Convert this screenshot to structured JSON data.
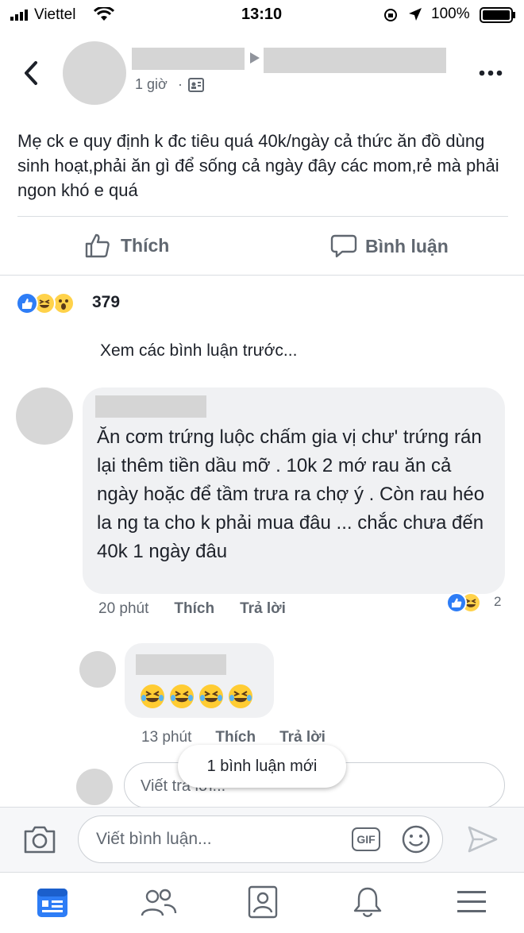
{
  "status_bar": {
    "carrier": "Viettel",
    "time": "13:10",
    "battery": "100%"
  },
  "post": {
    "time": "1 giờ",
    "text": "Mẹ ck e quy định k đc tiêu quá 40k/ngày cả thức ăn đồ dùng sinh hoạt,phải ăn gì để sống cả ngày đây các mom,rẻ mà phải ngon khó e quá",
    "like_label": "Thích",
    "comment_label": "Bình luận",
    "reaction_count": "379"
  },
  "comments": {
    "view_previous": "Xem các bình luận trước...",
    "first": {
      "text": "Ăn cơm trứng luộc chấm gia vị chư' trứng rán lại thêm tiền dầu mỡ . 10k 2 mớ rau ăn cả ngày hoặc để tầm trưa ra chợ ý . Còn rau héo la ng ta cho k phải mua đâu ... chắc chưa đến 40k 1 ngày đâu",
      "time": "20 phút",
      "like": "Thích",
      "reply": "Trả lời",
      "reaction_count": "2"
    },
    "reply": {
      "time": "13 phút",
      "like": "Thích",
      "reply": "Trả lời"
    },
    "reply_input_placeholder": "Viết trả lời...",
    "new_toast": "1 bình luận mới"
  },
  "composer": {
    "placeholder": "Viết bình luận...",
    "gif_label": "GIF"
  },
  "colors": {
    "accent": "#2e7df6",
    "reaction_yellow": "#ffd24a",
    "muted": "#606770"
  }
}
